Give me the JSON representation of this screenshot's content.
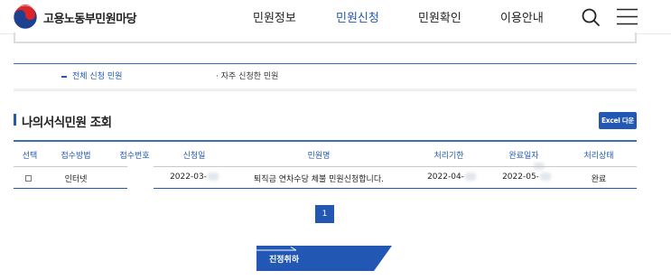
{
  "header": {
    "site_name": "고용노동부민원마당",
    "nav": [
      "민원정보",
      "민원신청",
      "민원확인",
      "이용안내"
    ],
    "active_nav": "민원신청",
    "icons": {
      "search": "search-icon",
      "menu": "hamburger-menu-icon",
      "logo": "taegeuk-emblem-icon"
    }
  },
  "tabs": [
    {
      "label": "전체 신청 민원",
      "active": true
    },
    {
      "label": "자주 신청한 민원",
      "active": false
    }
  ],
  "section": {
    "title": "나의서식민원 조회",
    "excel_button": "Excel 다운"
  },
  "table": {
    "headers": [
      "선택",
      "접수방법",
      "접수번호",
      "신청일",
      "민원명",
      "처리기한",
      "완료일자",
      "처리상태"
    ],
    "rows": [
      {
        "selected": false,
        "method": "인터넷",
        "receipt_no": "",
        "apply_date": "2022-03-",
        "name": "퇴직금 연차수당 체불 민원신청합니다.",
        "deadline": "2022-04-",
        "completed": "2022-05-",
        "status": "완료"
      }
    ]
  },
  "pagination": {
    "current": "1"
  },
  "actions": {
    "cancel_label": "진정취하"
  },
  "colors": {
    "accent": "#2257b4",
    "line": "#3a6fb0",
    "panel_border": "#dcdcdc"
  }
}
